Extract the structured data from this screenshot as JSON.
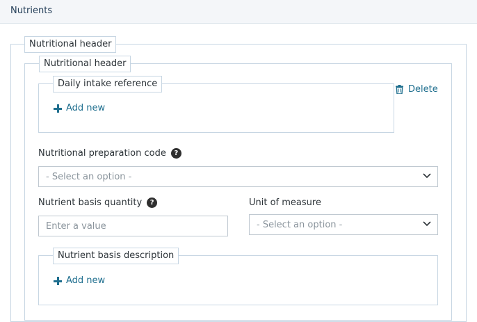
{
  "section": {
    "title": "Nutrients"
  },
  "outer": {
    "legend": "Nutritional header"
  },
  "inner": {
    "legend": "Nutritional header"
  },
  "daily_intake": {
    "legend": "Daily intake reference",
    "add_label": "Add new",
    "delete_label": "Delete"
  },
  "prep_code": {
    "label": "Nutritional preparation code",
    "help": "?",
    "selected": "- Select an option -"
  },
  "basis_quantity": {
    "label": "Nutrient basis quantity",
    "help": "?",
    "placeholder": "Enter a value",
    "value": ""
  },
  "unit": {
    "label": "Unit of measure",
    "selected": "- Select an option -"
  },
  "basis_description": {
    "legend": "Nutrient basis description",
    "add_label": "Add new"
  },
  "colors": {
    "accent": "#1e6e8e",
    "border": "#c7d6e3",
    "header_bg": "#f4f6f9"
  },
  "icons": {
    "add": "plus-icon",
    "delete": "trash-icon",
    "help": "help-icon",
    "dropdown": "chevron-down-icon"
  }
}
